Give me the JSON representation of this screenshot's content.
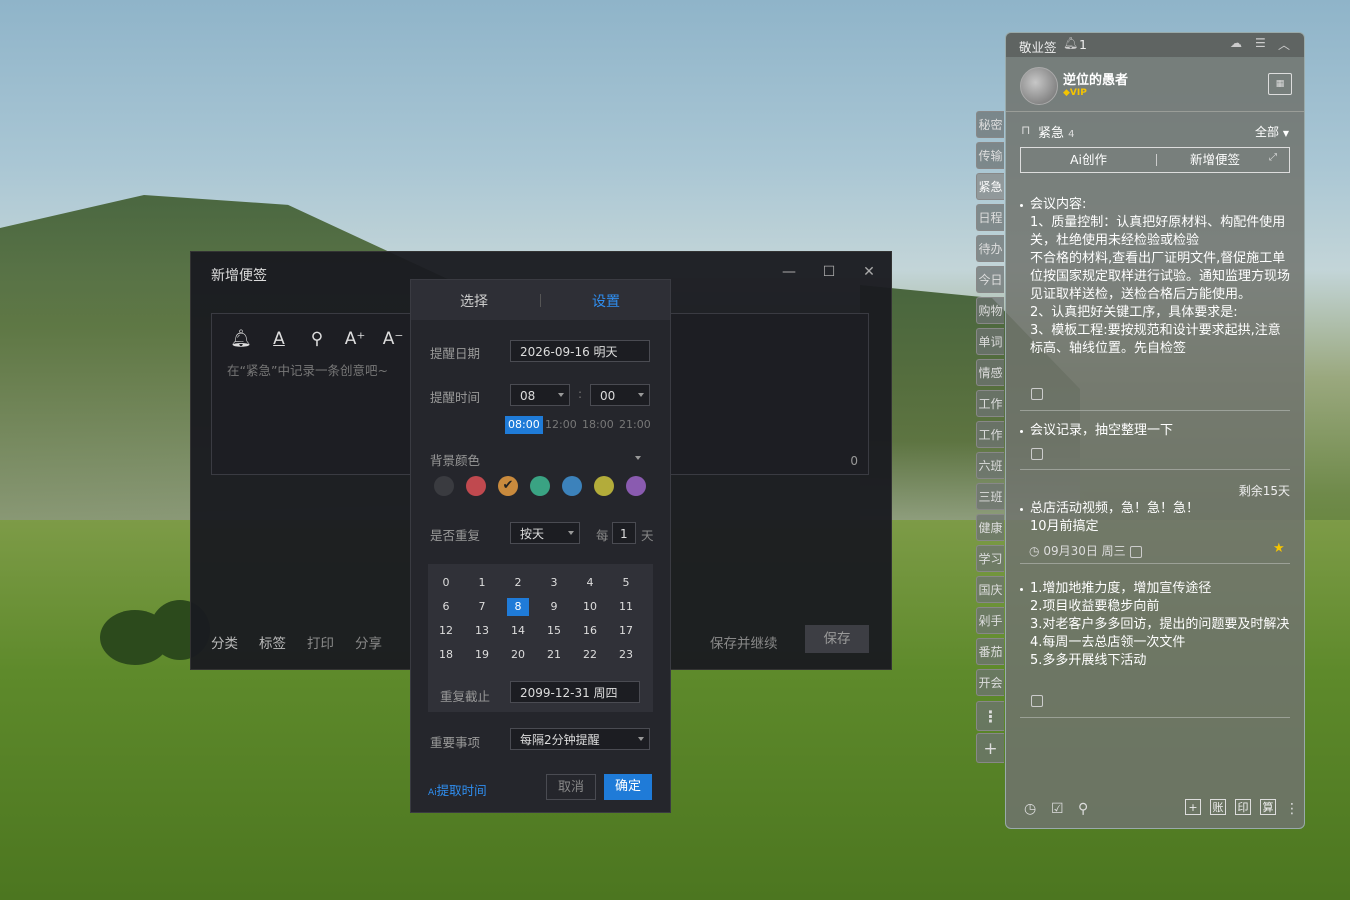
{
  "note_window": {
    "title": "新增便签",
    "placeholder": "在“紧急”中记录一条创意吧~",
    "char_count": "0",
    "bottom_links": [
      "分类",
      "标签",
      "打印",
      "分享"
    ],
    "save_continue": "保存并继续",
    "save": "保存"
  },
  "reminder": {
    "tabs": [
      "选择",
      "设置"
    ],
    "date_label": "提醒日期",
    "date_value": "2026-09-16 明天",
    "time_label": "提醒时间",
    "hour": "08",
    "colon": ":",
    "minute": "00",
    "quick_times": [
      "08:00",
      "12:00",
      "18:00",
      "21:00"
    ],
    "bg_label": "背景颜色",
    "colors": [
      "#3a3b40",
      "#c0494f",
      "#c98a3d",
      "#3aa383",
      "#3c82bb",
      "#b3ac3a",
      "#8a5bb0"
    ],
    "repeat_label": "是否重复",
    "repeat_mode": "按天",
    "every": "每",
    "interval": "1",
    "unit": "天",
    "calendar": [
      [
        "0",
        "1",
        "2",
        "3",
        "4",
        "5"
      ],
      [
        "6",
        "7",
        "8",
        "9",
        "10",
        "11"
      ],
      [
        "12",
        "13",
        "14",
        "15",
        "16",
        "17"
      ],
      [
        "18",
        "19",
        "20",
        "21",
        "22",
        "23"
      ]
    ],
    "repeat_end_label": "重复截止",
    "repeat_end": "2099-12-31 周四",
    "important_label": "重要事项",
    "important_value": "每隔2分钟提醒",
    "ai_extract": "提取时间",
    "cancel": "取消",
    "ok": "确定"
  },
  "side_tabs": [
    "秘密",
    "传输",
    "紧急",
    "日程",
    "待办",
    "今日",
    "购物",
    "单词",
    "情感",
    "工作",
    "工作",
    "六班",
    "三班",
    "健康",
    "学习",
    "国庆",
    "剁手",
    "番茄",
    "开会"
  ],
  "widget": {
    "app_name": "敬业签",
    "notify_count": "1",
    "username": "逆位的愚者",
    "vip": "VIP",
    "category": "紧急",
    "category_count": "4",
    "filter": "全部",
    "ai_create": "Ai创作",
    "new_note": "新增便签",
    "remaining": "剩余15天",
    "notes": [
      {
        "lines": [
          "会议内容:",
          "1、质量控制：认真把好原材料、构配件使用关，杜绝使用未经检验或检验",
          "不合格的材料,查看出厂证明文件,督促施工单位按国家规定取样进行试验。通知监理方现场见证取样送检，送检合格后方能使用。",
          "2、认真把好关键工序，具体要求是:",
          "3、模板工程:要按规范和设计要求起拱,注意标高、轴线位置。先自检签"
        ]
      },
      {
        "lines": [
          "会议记录，抽空整理一下"
        ]
      },
      {
        "lines": [
          "总店活动视频，急！急！急！",
          "10月前搞定"
        ],
        "date": "09月30日 周三"
      },
      {
        "lines": [
          "1.增加地推力度，增加宣传途径",
          "2.项目收益要稳步向前",
          "3.对老客户多多回访，提出的问题要及时解决",
          "4.每周一去总店领一次文件",
          "5.多多开展线下活动"
        ]
      }
    ],
    "footer_boxes": [
      "+",
      "账",
      "印",
      "算"
    ]
  }
}
